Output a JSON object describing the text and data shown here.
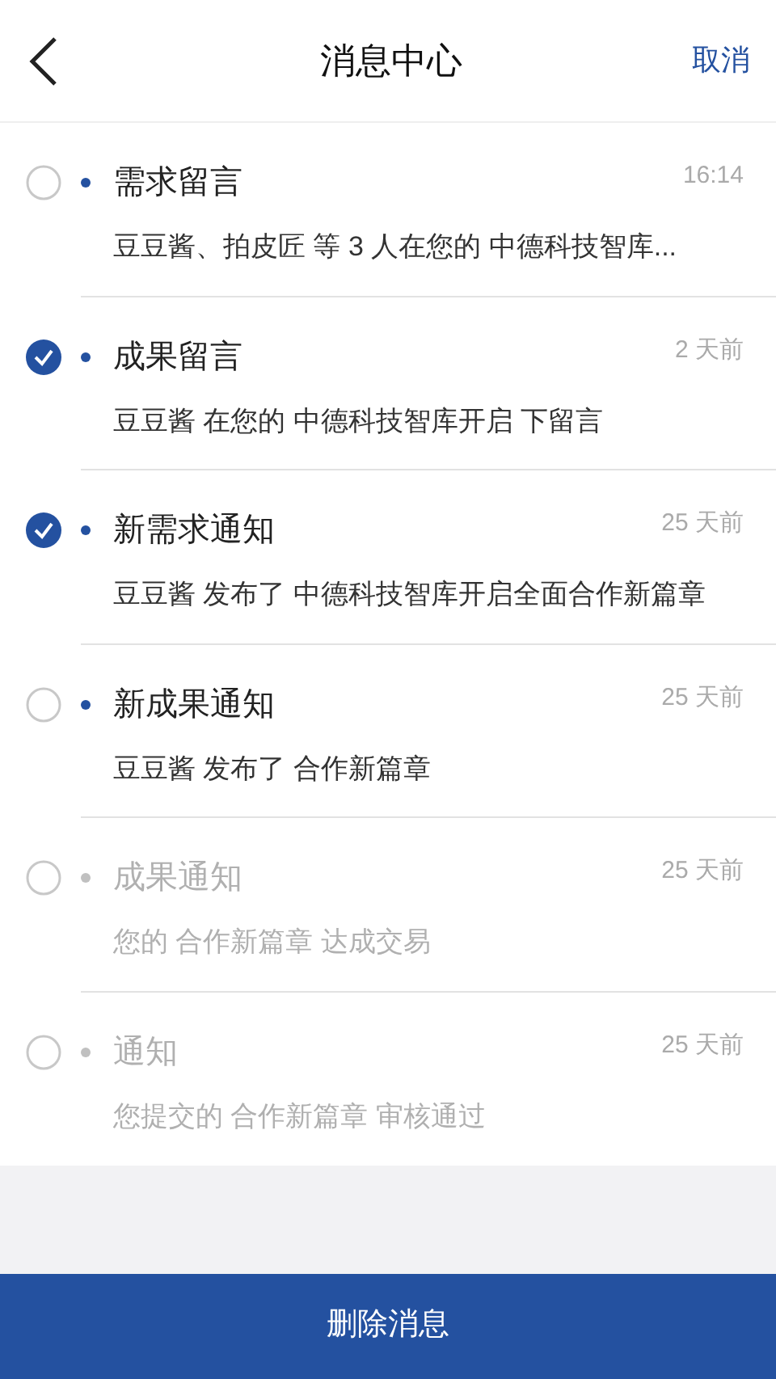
{
  "header": {
    "title": "消息中心",
    "action": "取消"
  },
  "messages": [
    {
      "title": "需求留言",
      "time": "16:14",
      "body": "豆豆酱、拍皮匠 等 3 人在您的 中德科技智库...",
      "checked": false,
      "unread": true
    },
    {
      "title": "成果留言",
      "time": "2 天前",
      "body": "豆豆酱 在您的 中德科技智库开启 下留言",
      "checked": true,
      "unread": true
    },
    {
      "title": "新需求通知",
      "time": "25 天前",
      "body": "豆豆酱 发布了 中德科技智库开启全面合作新篇章",
      "checked": true,
      "unread": true
    },
    {
      "title": "新成果通知",
      "time": "25 天前",
      "body": "豆豆酱 发布了 合作新篇章",
      "checked": false,
      "unread": true
    },
    {
      "title": "成果通知",
      "time": "25 天前",
      "body": "您的 合作新篇章 达成交易",
      "checked": false,
      "unread": false
    },
    {
      "title": "通知",
      "time": "25 天前",
      "body": "您提交的 合作新篇章 审核通过",
      "checked": false,
      "unread": false
    }
  ],
  "footer": {
    "button": "删除消息"
  }
}
